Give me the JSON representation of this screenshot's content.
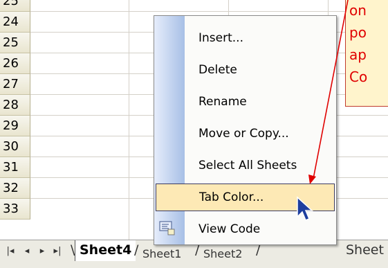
{
  "grid": {
    "rows": [
      "25",
      "24",
      "25",
      "26",
      "27",
      "28",
      "29",
      "30",
      "31",
      "32",
      "33"
    ]
  },
  "context_menu": {
    "items": [
      {
        "label": "Insert..."
      },
      {
        "label": "Delete"
      },
      {
        "label": "Rename"
      },
      {
        "label": "Move or Copy..."
      },
      {
        "label": "Select All Sheets"
      },
      {
        "label": "Tab Color..."
      },
      {
        "label": "View Code"
      }
    ],
    "highlighted_item": "Tab Color..."
  },
  "sheet_tabs": {
    "nav": [
      "|◂",
      "◂",
      "▸",
      "▸|"
    ],
    "tabs": [
      "Sheet4",
      "Sheet1",
      "Sheet2",
      "Sheet"
    ],
    "active": "Sheet4"
  },
  "callout": {
    "lines": [
      "on",
      "po",
      "ap",
      "Co"
    ],
    "border_color": "#c0392b",
    "text_color": "#e00000",
    "background": "#fff4cc"
  },
  "colors": {
    "menu_highlight": "#fde9b5",
    "menu_strip": "#a7bfe6",
    "row_header": "#e9e5cf"
  }
}
